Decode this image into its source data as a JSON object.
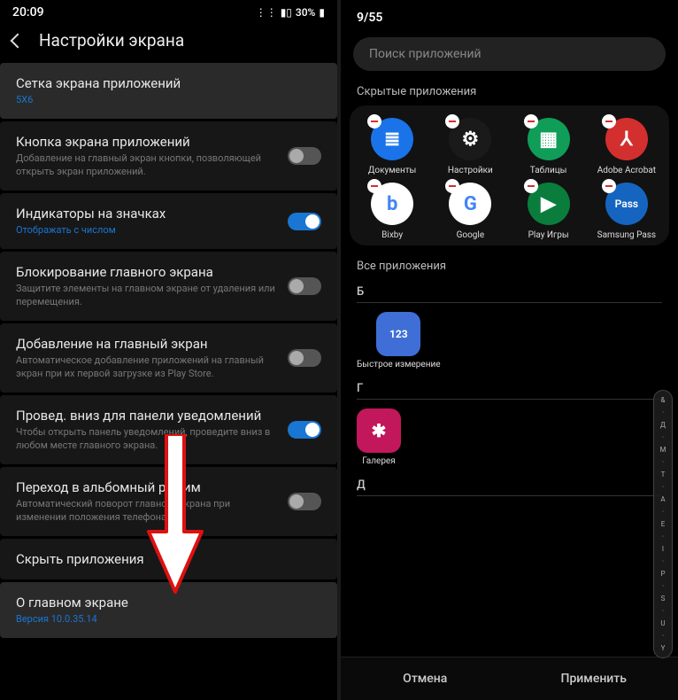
{
  "left": {
    "status": {
      "time": "20:09",
      "battery": "30%"
    },
    "header": {
      "title": "Настройки экрана"
    },
    "items": [
      {
        "title": "Сетка экрана приложений",
        "sub": "5X6",
        "subBlue": true,
        "highlighted": true
      },
      {
        "title": "Кнопка экрана приложений",
        "sub": "Добавление на главный экран кнопки, позволяющей открыть экран приложений.",
        "toggle": "off"
      },
      {
        "title": "Индикаторы на значках",
        "sub": "Отображать с числом",
        "subBlue": true,
        "toggle": "on"
      },
      {
        "title": "Блокирование главного экрана",
        "sub": "Защитите элементы на главном экране от удаления или перемещения.",
        "toggle": "off"
      },
      {
        "title": "Добавление на главный экран",
        "sub": "Автоматическое добавление приложений на главный экран при их первой загрузке из Play Store.",
        "toggle": "off"
      },
      {
        "title": "Провед. вниз для панели уведомлений",
        "sub": "Чтобы открыть панель уведомлений, проведите вниз в любом месте главного экрана.",
        "toggle": "on"
      },
      {
        "title": "Переход в альбомный режим",
        "sub": "Автоматический поворот главного экрана при изменении положения телефона.",
        "toggle": "off"
      },
      {
        "title": "Скрыть приложения"
      },
      {
        "title": "О главном экране",
        "sub": "Версия 10.0.35.14",
        "subBlue": true,
        "highlighted": true
      }
    ]
  },
  "right": {
    "counter": "9/55",
    "search_placeholder": "Поиск приложений",
    "hidden_label": "Скрытые приложения",
    "all_label": "Все приложения",
    "hidden_apps": [
      {
        "name": "Документы",
        "color": "#1a73e8",
        "glyph": "≣"
      },
      {
        "name": "Настройки",
        "color": "#1a1a1a",
        "glyph": "⚙"
      },
      {
        "name": "Таблицы",
        "color": "#0f9d58",
        "glyph": "▦"
      },
      {
        "name": "Adobe Acrobat",
        "color": "#d32f2f",
        "glyph": "⅄"
      },
      {
        "name": "Bixby",
        "color": "#fff",
        "glyph": "b"
      },
      {
        "name": "Google",
        "color": "#fff",
        "glyph": "G"
      },
      {
        "name": "Play Игры",
        "color": "#0a7d3c",
        "glyph": "▶"
      },
      {
        "name": "Samsung Pass",
        "color": "#1565c0",
        "glyph": "Pass"
      }
    ],
    "letters": [
      {
        "letter": "Б",
        "apps": [
          {
            "name": "Быстрое измерение",
            "color": "#3f6fd6",
            "glyph": "123"
          }
        ]
      },
      {
        "letter": "Г",
        "apps": [
          {
            "name": "Галерея",
            "color": "#c2185b",
            "glyph": "✱"
          }
        ]
      },
      {
        "letter": "Д",
        "apps": []
      }
    ],
    "index": [
      "&",
      "·",
      "Д",
      "·",
      "М",
      "·",
      "Т",
      "·",
      "А",
      "·",
      "Е",
      "·",
      "I",
      "·",
      "P",
      "·",
      "S",
      "·",
      "U",
      "·",
      "Y"
    ],
    "actions": {
      "cancel": "Отмена",
      "apply": "Применить"
    }
  }
}
